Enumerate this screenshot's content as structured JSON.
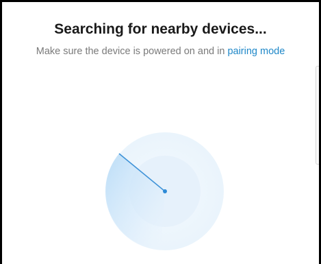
{
  "dialog": {
    "title": "Searching for nearby devices...",
    "subtitle_text": "Make sure the device is powered on and in ",
    "subtitle_link": "pairing mode"
  },
  "radar": {
    "icon": "radar-scan-icon",
    "state": "scanning"
  },
  "colors": {
    "accent": "#1e87c8",
    "radar_sweep": "#5aa8e6",
    "radar_ring": "#eaf4fc"
  }
}
